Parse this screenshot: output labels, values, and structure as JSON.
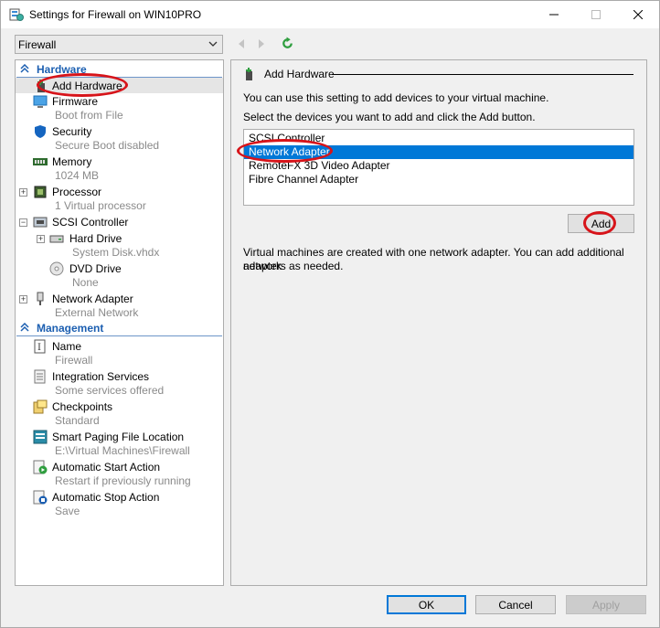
{
  "window": {
    "title": "Settings for Firewall on WIN10PRO",
    "minimize_icon": "minimize-icon",
    "maximize_icon": "maximize-icon",
    "close_icon": "close-icon"
  },
  "toolbar": {
    "vm_selector_value": "Firewall"
  },
  "sidebar": {
    "hardware_header": "Hardware",
    "management_header": "Management",
    "hardware_items": [
      {
        "label": "Add Hardware",
        "sub": "",
        "icon": "add-hardware-icon"
      },
      {
        "label": "Firmware",
        "sub": "Boot from File",
        "icon": "firmware-icon"
      },
      {
        "label": "Security",
        "sub": "Secure Boot disabled",
        "icon": "shield-icon"
      },
      {
        "label": "Memory",
        "sub": "1024 MB",
        "icon": "memory-icon"
      },
      {
        "label": "Processor",
        "sub": "1 Virtual processor",
        "icon": "processor-icon"
      },
      {
        "label": "SCSI Controller",
        "sub": "",
        "icon": "scsi-controller-icon"
      },
      {
        "label": "Hard Drive",
        "sub": "System Disk.vhdx",
        "icon": "hard-drive-icon"
      },
      {
        "label": "DVD Drive",
        "sub": "None",
        "icon": "dvd-drive-icon"
      },
      {
        "label": "Network Adapter",
        "sub": "External Network",
        "icon": "network-adapter-icon"
      }
    ],
    "management_items": [
      {
        "label": "Name",
        "sub": "Firewall",
        "icon": "name-icon"
      },
      {
        "label": "Integration Services",
        "sub": "Some services offered",
        "icon": "integration-services-icon"
      },
      {
        "label": "Checkpoints",
        "sub": "Standard",
        "icon": "checkpoints-icon"
      },
      {
        "label": "Smart Paging File Location",
        "sub": "E:\\Virtual Machines\\Firewall",
        "icon": "smart-paging-icon"
      },
      {
        "label": "Automatic Start Action",
        "sub": "Restart if previously running",
        "icon": "automatic-start-icon"
      },
      {
        "label": "Automatic Stop Action",
        "sub": "Save",
        "icon": "automatic-stop-icon"
      }
    ]
  },
  "main": {
    "section_title": "Add Hardware",
    "intro_text": "You can use this setting to add devices to your virtual machine.",
    "instruction_text": "Select the devices you want to add and click the Add button.",
    "devices": [
      "SCSI Controller",
      "Network Adapter",
      "RemoteFX 3D Video Adapter",
      "Fibre Channel Adapter"
    ],
    "selected_device": "Network Adapter",
    "add_button": "Add",
    "note_line1": "Virtual machines are created with one network adapter. You can add additional network",
    "note_line2": "adapters as needed."
  },
  "footer": {
    "ok_label": "OK",
    "cancel_label": "Cancel",
    "apply_label": "Apply"
  },
  "colors": {
    "selection": "#0078d7",
    "header_blue": "#1c5fb1",
    "annotation_red": "#d7141a"
  }
}
